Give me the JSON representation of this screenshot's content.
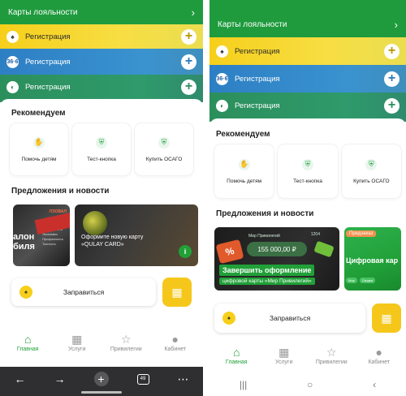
{
  "left": {
    "loyalty": {
      "title": "Карты лояльности",
      "arrow": "›"
    },
    "cards": [
      {
        "logo": "♠",
        "label": "Регистрация",
        "plus": "+"
      },
      {
        "logo": "36·6",
        "label": "Регистрация",
        "plus": "+"
      },
      {
        "logo": "◐",
        "label": "Регистрация",
        "plus": "+"
      }
    ],
    "recommend": {
      "title": "Рекомендуем",
      "items": [
        {
          "label": "Помочь детям",
          "icon": "hand-icon"
        },
        {
          "label": "Тест-кнопка",
          "icon": "shield-icon"
        },
        {
          "label": "Купить ОСАГО",
          "icon": "shield-icon"
        }
      ]
    },
    "news": {
      "title": "Предложения и новости",
      "card1": {
        "brand": "ЛЭОВАЛ",
        "line1": "алон",
        "line2": "биля",
        "bullets": [
          "Мобильность",
          "Экономия",
          "Прозрачность",
          "Точность"
        ]
      },
      "card2": {
        "title": "Оформите новую карту «QULAY CARD»"
      }
    },
    "refuel": {
      "label": "Заправиться"
    },
    "tabs": [
      {
        "label": "Главная",
        "icon": "home-icon"
      },
      {
        "label": "Услуги",
        "icon": "grid-icon"
      },
      {
        "label": "Привилегии",
        "icon": "star-icon"
      },
      {
        "label": "Кабинет",
        "icon": "person-icon"
      }
    ],
    "browser": {
      "tab_count": "49"
    }
  },
  "right": {
    "loyalty": {
      "title": "Карты лояльности",
      "arrow": "›"
    },
    "cards": [
      {
        "logo": "♠",
        "label": "Регистрация",
        "plus": "+"
      },
      {
        "logo": "36·6",
        "label": "Регистрация",
        "plus": "+"
      },
      {
        "logo": "◐",
        "label": "Регистрация",
        "plus": "+"
      }
    ],
    "recommend": {
      "title": "Рекомендуем",
      "items": [
        {
          "label": "Помочь детям",
          "icon": "hand-icon"
        },
        {
          "label": "Тест-кнопка",
          "icon": "shield-icon"
        },
        {
          "label": "Купить ОСАГО",
          "icon": "shield-icon"
        }
      ]
    },
    "news": {
      "title": "Предложения и новости",
      "card1": {
        "brand": "Мир Привилегий",
        "amount": "155 000,00 ₽",
        "num": "1204",
        "line1": "Завершить оформление",
        "line2": "цифровой карты «Мир Привилегий»"
      },
      "card2": {
        "badge": "Предзаказ",
        "title": "Цифровая кар",
        "tag1": "Мир",
        "tag2": "Скидки"
      }
    },
    "refuel": {
      "label": "Заправиться"
    },
    "tabs": [
      {
        "label": "Главная",
        "icon": "home-icon"
      },
      {
        "label": "Услуги",
        "icon": "grid-icon"
      },
      {
        "label": "Привилегии",
        "icon": "star-icon"
      },
      {
        "label": "Кабинет",
        "icon": "person-icon"
      }
    ]
  }
}
